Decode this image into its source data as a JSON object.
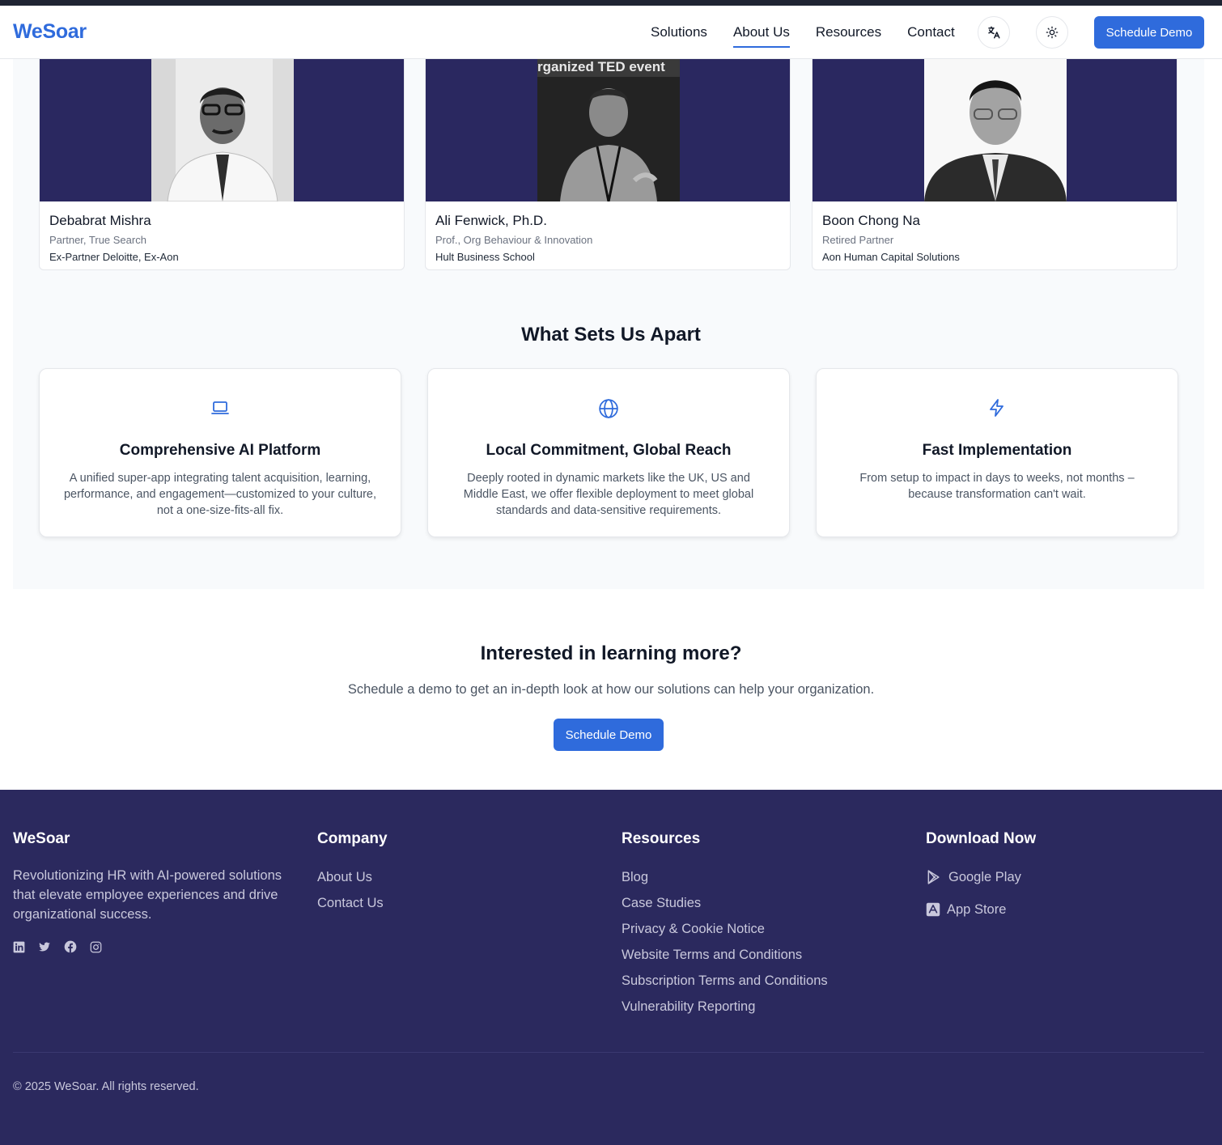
{
  "nav": {
    "logo": "WeSoar",
    "links": [
      "Solutions",
      "About Us",
      "Resources",
      "Contact"
    ],
    "active": "About Us",
    "language_icon": "translate-icon",
    "theme_icon": "sun-icon",
    "cta": "Schedule Demo"
  },
  "team": [
    {
      "name": "Debabrat Mishra",
      "role": "Partner, True Search",
      "org": "Ex-Partner Deloitte, Ex-Aon"
    },
    {
      "name": "Ali Fenwick, Ph.D.",
      "role": "Prof., Org Behaviour & Innovation",
      "org": "Hult Business School",
      "photo_caption": "rganized TED event"
    },
    {
      "name": "Boon Chong Na",
      "role": "Retired Partner",
      "org": "Aon Human Capital Solutions"
    }
  ],
  "apart": {
    "title": "What Sets Us Apart",
    "cards": [
      {
        "icon": "laptop-icon",
        "title": "Comprehensive AI Platform",
        "desc": "A unified super-app integrating talent acquisition, learning, performance, and engagement—customized to your culture, not a one-size-fits-all fix."
      },
      {
        "icon": "globe-icon",
        "title": "Local Commitment, Global Reach",
        "desc": "Deeply rooted in dynamic markets like the UK, US and Middle East, we offer flexible deployment to meet global standards and data-sensitive requirements."
      },
      {
        "icon": "lightning-icon",
        "title": "Fast Implementation",
        "desc": "From setup to impact in days to weeks, not months – because transformation can't wait."
      }
    ]
  },
  "cta": {
    "title": "Interested in learning more?",
    "subtitle": "Schedule a demo to get an in-depth look at how our solutions can help your organization.",
    "button": "Schedule Demo"
  },
  "footer": {
    "brand": "WeSoar",
    "description": "Revolutionizing HR with AI-powered solutions that elevate employee experiences and drive organizational success.",
    "socials": [
      "linkedin-icon",
      "twitter-icon",
      "facebook-icon",
      "instagram-icon"
    ],
    "company": {
      "title": "Company",
      "links": [
        "About Us",
        "Contact Us"
      ]
    },
    "resources": {
      "title": "Resources",
      "links": [
        "Blog",
        "Case Studies",
        "Privacy & Cookie Notice",
        "Website Terms and Conditions",
        "Subscription Terms and Conditions",
        "Vulnerability Reporting"
      ]
    },
    "download": {
      "title": "Download Now",
      "google_play": "Google Play",
      "app_store": "App Store"
    },
    "copyright": "© 2025 WeSoar. All rights reserved."
  },
  "colors": {
    "accent": "#2f6bdc",
    "footer_bg": "#2b295e",
    "photo_bg": "#2a2860",
    "section_bg": "#f8fafc"
  }
}
